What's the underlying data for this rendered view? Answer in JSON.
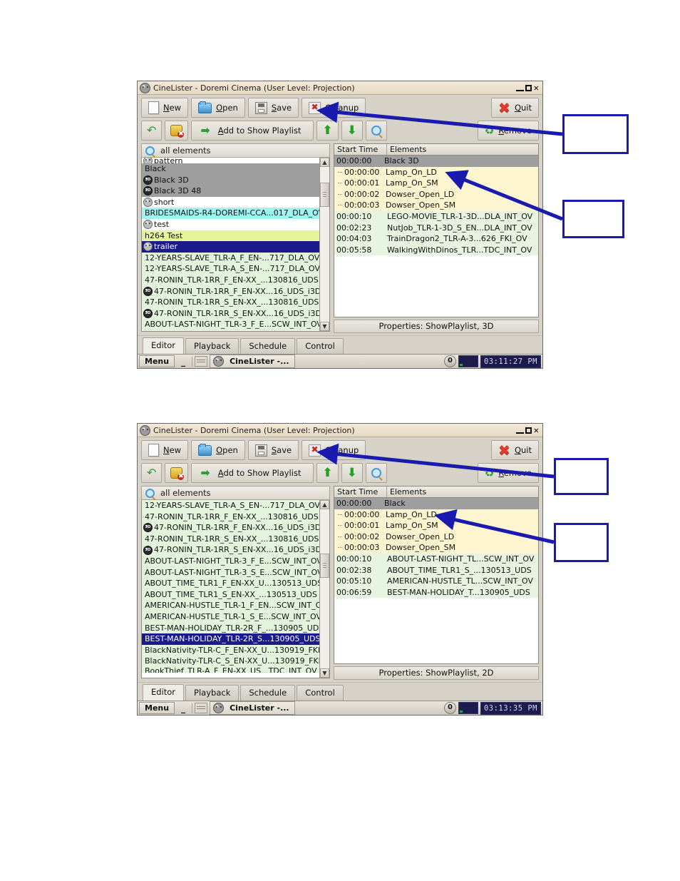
{
  "app": {
    "title": "CineLister - Doremi Cinema (User Level: Projection)",
    "window_buttons": {
      "minimize": "_",
      "maximize": "□",
      "close": "✕"
    }
  },
  "toolbar_main": [
    {
      "label": "New",
      "icon": "new-document-icon"
    },
    {
      "label": "Open",
      "icon": "open-folder-icon"
    },
    {
      "label": "Save",
      "icon": "save-disk-icon"
    },
    {
      "label": "Cleanup",
      "icon": "cleanup-x-icon"
    },
    {
      "label": "Quit",
      "icon": "quit-x-icon"
    }
  ],
  "toolbar_edit": {
    "undo": "undo-arrow-icon",
    "delete": "delete-item-icon",
    "add_label": "Add to Show Playlist",
    "add_icon": "right-arrow-icon",
    "move_up": "up-arrow-icon",
    "move_down": "down-arrow-icon",
    "inspect": "magnifier-icon",
    "remove_label": "Remove",
    "remove_icon": "remove-recycle-icon"
  },
  "search": {
    "placeholder": "all elements",
    "value": "all elements",
    "icon": "search-icon"
  },
  "playlist_header": {
    "start_time": "Start Time",
    "elements": "Elements"
  },
  "tabs": [
    {
      "label": "Editor",
      "active": true
    },
    {
      "label": "Playback",
      "active": false
    },
    {
      "label": "Schedule",
      "active": false
    },
    {
      "label": "Control",
      "active": false
    }
  ],
  "taskbar": {
    "menu": "Menu",
    "minimize": "_",
    "task_label": "CineLister -...",
    "counter": "0"
  },
  "window1": {
    "clock": "03:11:27 PM",
    "properties": "Properties: ShowPlaylist, 3D",
    "left_list": [
      {
        "label": "pattern",
        "style": "white",
        "badge": "face",
        "partial": "top"
      },
      {
        "label": "Black",
        "style": "grey",
        "badge": "none"
      },
      {
        "label": "Black 3D",
        "style": "grey",
        "badge": "3d"
      },
      {
        "label": "Black 3D 48",
        "style": "grey",
        "badge": "3d"
      },
      {
        "label": "short",
        "style": "white",
        "badge": "face"
      },
      {
        "label": "BRIDESMAIDS-R4-DOREMI-CCA...017_DLA_OV",
        "style": "cyan",
        "badge": "none"
      },
      {
        "label": "test",
        "style": "white",
        "badge": "face"
      },
      {
        "label": "h264 Test",
        "style": "yellow",
        "badge": "none"
      },
      {
        "label": "trailer",
        "style": "sel",
        "badge": "face"
      },
      {
        "label": "12-YEARS-SLAVE_TLR-A_F_EN-...717_DLA_OV",
        "style": "green",
        "badge": "none"
      },
      {
        "label": "12-YEARS-SLAVE_TLR-A_S_EN-...717_DLA_OV",
        "style": "green",
        "badge": "none"
      },
      {
        "label": "47-RONIN_TLR-1RR_F_EN-XX_...130816_UDS",
        "style": "green",
        "badge": "none"
      },
      {
        "label": "47-RONIN_TLR-1RR_F_EN-XX...16_UDS_i3D",
        "style": "green",
        "badge": "3d"
      },
      {
        "label": "47-RONIN_TLR-1RR_S_EN-XX_...130816_UDS",
        "style": "green",
        "badge": "none"
      },
      {
        "label": "47-RONIN_TLR-1RR_S_EN-XX...16_UDS_i3D",
        "style": "green",
        "badge": "3d"
      },
      {
        "label": "ABOUT-LAST-NIGHT_TLR-3_F_E...SCW_INT_OV",
        "style": "green",
        "badge": "none"
      }
    ],
    "playlist": [
      {
        "time": "00:00:00",
        "name": "Black 3D",
        "style": "hdr-sel"
      },
      {
        "time": "00:00:00",
        "name": "Lamp_On_LD",
        "style": "cue"
      },
      {
        "time": "00:00:01",
        "name": "Lamp_On_SM",
        "style": "cue"
      },
      {
        "time": "00:00:02",
        "name": "Dowser_Open_LD",
        "style": "cue"
      },
      {
        "time": "00:00:03",
        "name": "Dowser_Open_SM",
        "style": "cue"
      },
      {
        "time": "00:00:10",
        "name": "LEGO-MOVIE_TLR-1-3D...DLA_INT_OV",
        "style": "item"
      },
      {
        "time": "00:02:23",
        "name": "NutJob_TLR-1-3D_S_EN...DLA_INT_OV",
        "style": "item"
      },
      {
        "time": "00:04:03",
        "name": "TrainDragon2_TLR-A-3...626_FKI_OV",
        "style": "item"
      },
      {
        "time": "00:05:58",
        "name": "WalkingWithDinos_TLR...TDC_INT_OV",
        "style": "item"
      }
    ]
  },
  "window2": {
    "clock": "03:13:35 PM",
    "properties": "Properties: ShowPlaylist, 2D",
    "left_list": [
      {
        "label": "12-YEARS-SLAVE_TLR-A_S_EN-...717_DLA_OV",
        "style": "green",
        "badge": "none"
      },
      {
        "label": "47-RONIN_TLR-1RR_F_EN-XX_...130816_UDS",
        "style": "green",
        "badge": "none"
      },
      {
        "label": "47-RONIN_TLR-1RR_F_EN-XX...16_UDS_i3D",
        "style": "green",
        "badge": "3d"
      },
      {
        "label": "47-RONIN_TLR-1RR_S_EN-XX_...130816_UDS",
        "style": "green",
        "badge": "none"
      },
      {
        "label": "47-RONIN_TLR-1RR_S_EN-XX...16_UDS_i3D",
        "style": "green",
        "badge": "3d"
      },
      {
        "label": "ABOUT-LAST-NIGHT_TLR-3_F_E...SCW_INT_OV",
        "style": "green",
        "badge": "none"
      },
      {
        "label": "ABOUT-LAST-NIGHT_TLR-3_S_E...SCW_INT_OV",
        "style": "green",
        "badge": "none"
      },
      {
        "label": "ABOUT_TIME_TLR1_F_EN-XX_U...130513_UDS",
        "style": "green",
        "badge": "none"
      },
      {
        "label": "ABOUT_TIME_TLR1_S_EN-XX_...130513_UDS",
        "style": "green",
        "badge": "none"
      },
      {
        "label": "AMERICAN-HUSTLE_TLR-1_F_EN...SCW_INT_OV",
        "style": "green",
        "badge": "none"
      },
      {
        "label": "AMERICAN-HUSTLE_TLR-1_S_E...SCW_INT_OV",
        "style": "green",
        "badge": "none"
      },
      {
        "label": "BEST-MAN-HOLIDAY_TLR-2R_F_...130905_UDS",
        "style": "green",
        "badge": "none"
      },
      {
        "label": "BEST-MAN-HOLIDAY_TLR-2R_S...130905_UDS",
        "style": "sel",
        "badge": "none"
      },
      {
        "label": "BlackNativity-TLR-C_F_EN-XX_U...130919_FKI",
        "style": "green",
        "badge": "none"
      },
      {
        "label": "BlackNativity-TLR-C_S_EN-XX_U...130919_FKI",
        "style": "green",
        "badge": "none"
      },
      {
        "label": "BookThief_TLR-A_F_EN-XX_US...TDC_INT_OV",
        "style": "green",
        "badge": "none",
        "partial": "bottom"
      }
    ],
    "playlist": [
      {
        "time": "00:00:00",
        "name": "Black",
        "style": "hdr-sel"
      },
      {
        "time": "00:00:00",
        "name": "Lamp_On_LD",
        "style": "cue"
      },
      {
        "time": "00:00:01",
        "name": "Lamp_On_SM",
        "style": "cue"
      },
      {
        "time": "00:00:02",
        "name": "Dowser_Open_LD",
        "style": "cue"
      },
      {
        "time": "00:00:03",
        "name": "Dowser_Open_SM",
        "style": "cue"
      },
      {
        "time": "00:00:10",
        "name": "ABOUT-LAST-NIGHT_TL...SCW_INT_OV",
        "style": "item"
      },
      {
        "time": "00:02:38",
        "name": "ABOUT_TIME_TLR1_S_...130513_UDS",
        "style": "item"
      },
      {
        "time": "00:05:10",
        "name": "AMERICAN-HUSTLE_TL...SCW_INT_OV",
        "style": "item"
      },
      {
        "time": "00:06:59",
        "name": "BEST-MAN-HOLIDAY_T...130905_UDS",
        "style": "item"
      }
    ]
  },
  "annotations": {
    "accent_color": "#1a1aae",
    "callouts": [
      {
        "id": "callout-1",
        "text": ""
      },
      {
        "id": "callout-2",
        "text": ""
      },
      {
        "id": "callout-3",
        "text": ""
      },
      {
        "id": "callout-4",
        "text": ""
      }
    ]
  }
}
